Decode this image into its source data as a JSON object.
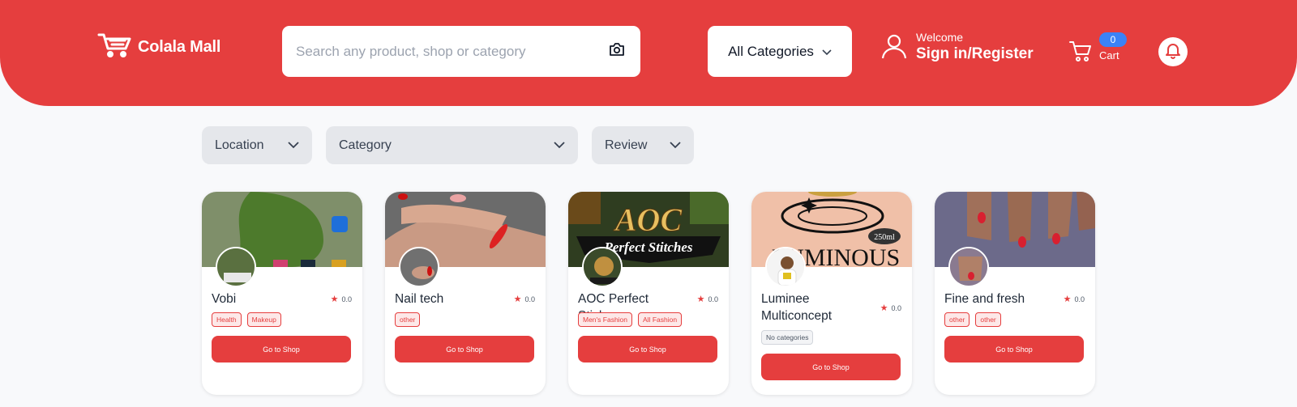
{
  "header": {
    "logo_text": "Colala Mall",
    "search_placeholder": "Search any product, shop or category",
    "category_select": "All Categories",
    "welcome": "Welcome",
    "signin": "Sign in/Register",
    "cart_count": "0",
    "cart_label": "Cart"
  },
  "filters": {
    "location": "Location",
    "category": "Category",
    "review": "Review"
  },
  "shops": [
    {
      "name": "Vobi",
      "rating": "0.0",
      "tags": [
        "Health",
        "Makeup"
      ],
      "button": "Go to Shop"
    },
    {
      "name": "Nail tech",
      "rating": "0.0",
      "tags": [
        "other"
      ],
      "button": "Go to Shop"
    },
    {
      "name": "AOC Perfect Stiches",
      "rating": "0.0",
      "tags": [
        "Men's Fashion",
        "All Fashion"
      ],
      "button": "Go to Shop"
    },
    {
      "name": "Luminee Multiconcept",
      "rating": "0.0",
      "tags": [
        "No categories"
      ],
      "button": "Go to Shop"
    },
    {
      "name": "Fine and fresh",
      "rating": "0.0",
      "tags": [
        "other",
        "other"
      ],
      "button": "Go to Shop"
    }
  ],
  "banner_text": {
    "aoc_main": "AOC",
    "aoc_sub": "Perfect Stitches",
    "luminous": "LUMINOUS",
    "luminous_volume": "250ml"
  },
  "colors": {
    "brand_red": "#e53e3e",
    "badge_blue": "#3b82f6"
  }
}
